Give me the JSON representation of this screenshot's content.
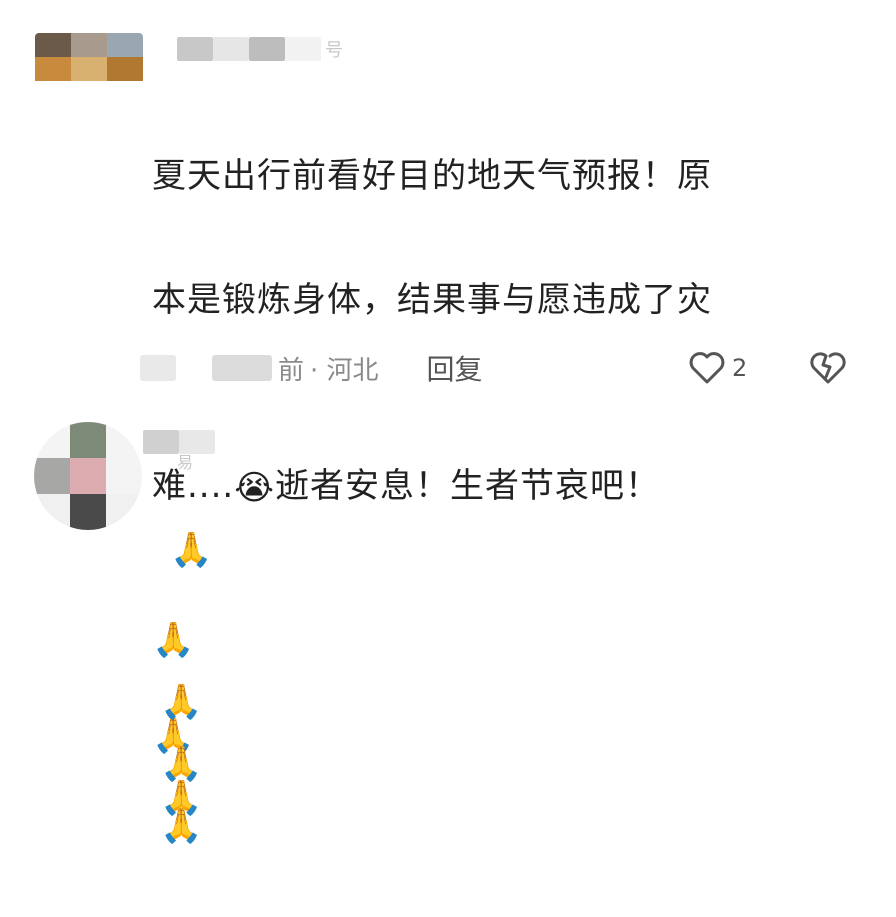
{
  "comments": [
    {
      "username_tail": "号",
      "text_line1": "夏天出行前看好目的地天气预报！原",
      "text_line2": "本是锻炼身体，结果事与愿违成了灾",
      "text_line3_a": "难....",
      "text_line3_b": "逝者安息！生者节哀吧！",
      "emoji_cry": "😭",
      "emoji_pray": "🙏",
      "meta_time_tail": "前",
      "meta_location": "· 河北",
      "reply_label": "回复",
      "like_count": "2"
    },
    {
      "username_tail": "易",
      "emoji_pray": "🙏"
    }
  ]
}
